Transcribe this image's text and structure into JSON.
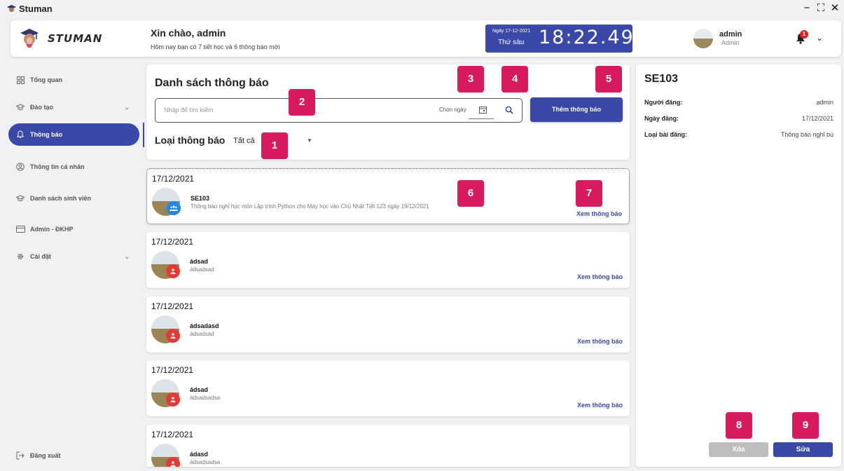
{
  "window": {
    "title": "Stuman"
  },
  "header": {
    "logo_text": "STUMAN",
    "greeting": "Xin chào,  admin",
    "subtext": "Hôm nay bạn có 7 tiết học và 6 thông báo mới",
    "clock": {
      "date": "Ngày 17-12-2021",
      "day": "Thứ sáu",
      "time": "18:22.49"
    },
    "user": {
      "name": "admin",
      "role": "Admin"
    },
    "notification_count": "1"
  },
  "sidebar": {
    "items": [
      {
        "label": "Tổng quan",
        "icon": "grid-icon"
      },
      {
        "label": "Đào tạo",
        "icon": "graduation-cap-icon",
        "has_chevron": true
      },
      {
        "label": "Thông báo",
        "icon": "bell-icon",
        "active": true
      },
      {
        "label": "Thông tin cá nhân",
        "icon": "user-circle-icon"
      },
      {
        "label": "Danh sách sinh viên",
        "icon": "graduation-cap-icon"
      },
      {
        "label": "Admin - ĐKHP",
        "icon": "card-icon"
      },
      {
        "label": "Cài đặt",
        "icon": "gear-icon",
        "has_chevron": true
      }
    ],
    "logout": "Đăng xuất"
  },
  "list": {
    "title": "Danh sách thông báo",
    "search_placeholder": "Nhập để tìm kiếm",
    "date_label": "Chọn ngày",
    "add_button": "Thêm thông báo",
    "type_label": "Loại thông báo",
    "type_value": "Tất cả",
    "view_label": "Xem thông báo",
    "cards": [
      {
        "date": "17/12/2021",
        "title": "SE103",
        "desc": "Thông báo nghỉ học môn Lập trình Python cho Máy học vào Chủ Nhật Tiết 123 ngày 19/12/2021",
        "badge": "group",
        "badge_color": "#1e88e5"
      },
      {
        "date": "17/12/2021",
        "title": "ádsad",
        "desc": "ádsadsad",
        "badge": "person",
        "badge_color": "#e53935"
      },
      {
        "date": "17/12/2021",
        "title": "ádsadasd",
        "desc": "ádsadsad",
        "badge": "person",
        "badge_color": "#e53935"
      },
      {
        "date": "17/12/2021",
        "title": "ádsad",
        "desc": "ádsadsadsa",
        "badge": "person",
        "badge_color": "#e53935"
      },
      {
        "date": "17/12/2021",
        "title": "ádasd",
        "desc": "ádsadsadsa",
        "badge": "person",
        "badge_color": "#e53935"
      }
    ]
  },
  "detail": {
    "title": "SE103",
    "rows": [
      {
        "key": "Người đăng:",
        "value": "admin"
      },
      {
        "key": "Ngày đăng:",
        "value": "17/12/2021"
      },
      {
        "key": "Loại bài đăng:",
        "value": "Thông báo nghỉ bù"
      }
    ],
    "delete_button": "Xóa",
    "edit_button": "Sửa"
  },
  "markers": [
    "1",
    "2",
    "3",
    "4",
    "5",
    "6",
    "7",
    "8",
    "9"
  ],
  "colors": {
    "primary": "#3a48a8",
    "marker": "#d81b60",
    "badge_red": "#e53935",
    "badge_blue": "#1e88e5"
  }
}
